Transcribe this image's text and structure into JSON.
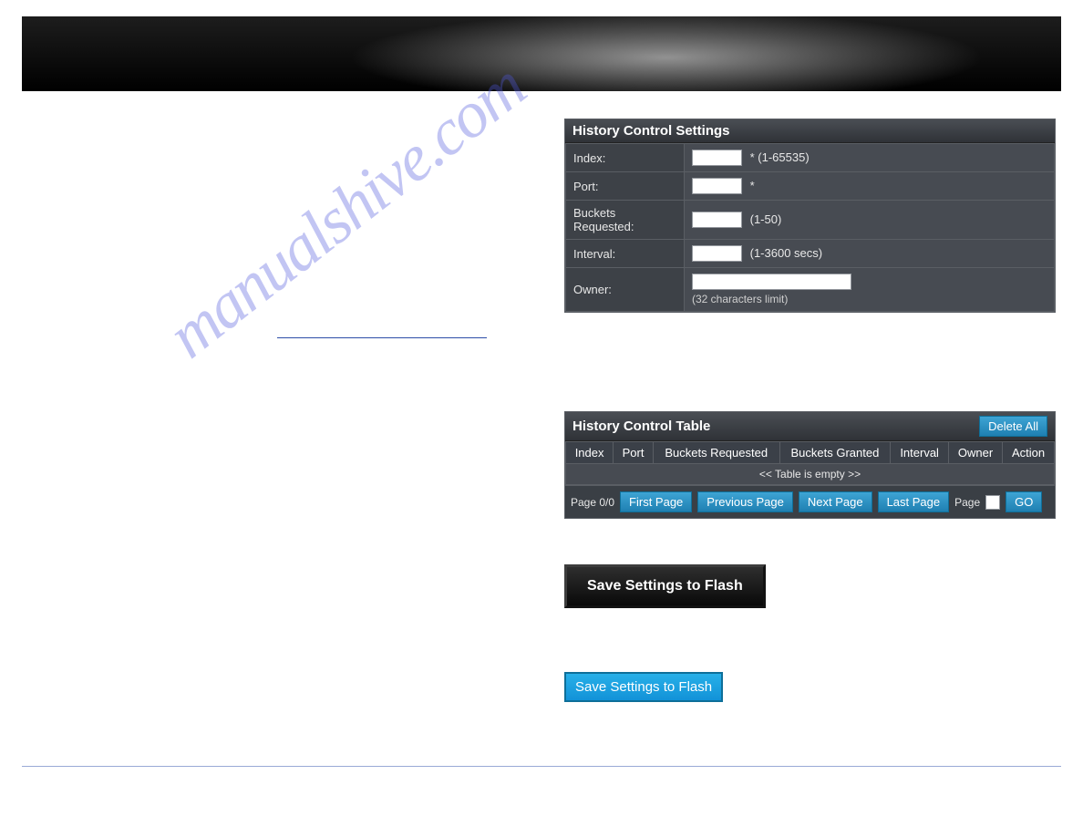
{
  "watermark": "manualshive.com",
  "settings_panel": {
    "title": "History Control Settings",
    "fields": {
      "index": {
        "label": "Index:",
        "hint": "* (1-65535)"
      },
      "port": {
        "label": "Port:",
        "hint": "*"
      },
      "buckets": {
        "label": "Buckets Requested:",
        "hint": "(1-50)"
      },
      "interval": {
        "label": "Interval:",
        "hint": "(1-3600 secs)"
      },
      "owner": {
        "label": "Owner:",
        "hint": "(32 characters limit)"
      }
    }
  },
  "table_panel": {
    "title": "History Control Table",
    "delete_all": "Delete All",
    "columns": {
      "index": "Index",
      "port": "Port",
      "buckets_req": "Buckets Requested",
      "buckets_granted": "Buckets Granted",
      "interval": "Interval",
      "owner": "Owner",
      "action": "Action"
    },
    "empty_text": "<< Table is empty >>",
    "pager": {
      "pos": "Page 0/0",
      "first": "First Page",
      "prev": "Previous Page",
      "next": "Next Page",
      "last": "Last Page",
      "page_label": "Page",
      "go": "GO"
    }
  },
  "save_flash": {
    "menu_label": "Save Settings to Flash",
    "button_label": "Save Settings to Flash"
  }
}
